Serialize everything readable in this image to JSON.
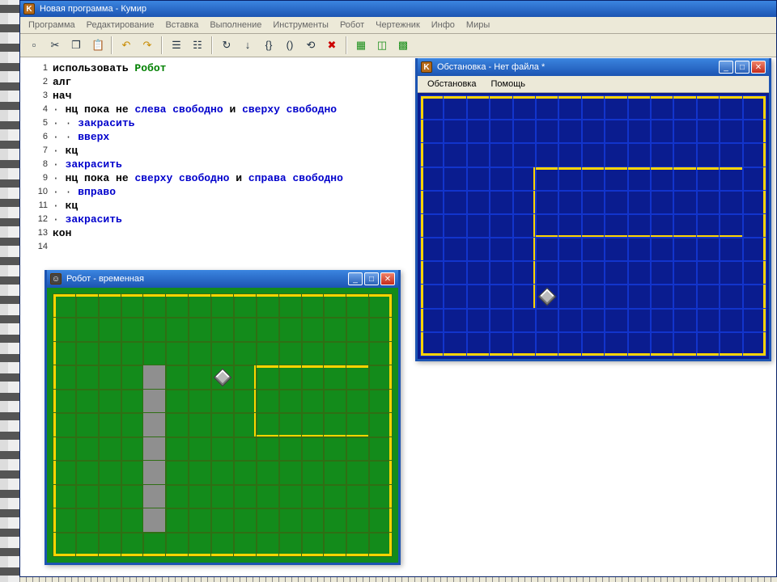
{
  "main_title": "Новая программа - Кумир",
  "menubar": [
    "Программа",
    "Редактирование",
    "Вставка",
    "Выполнение",
    "Инструменты",
    "Робот",
    "Чертежник",
    "Инфо",
    "Миры"
  ],
  "toolbar_icons": [
    {
      "name": "new-icon",
      "glyph": "▫"
    },
    {
      "name": "cut-icon",
      "glyph": "✂"
    },
    {
      "name": "copy-icon",
      "glyph": "❐"
    },
    {
      "name": "paste-icon",
      "glyph": "📋"
    },
    {
      "name": "sep"
    },
    {
      "name": "undo-icon",
      "glyph": "↶"
    },
    {
      "name": "redo-icon",
      "glyph": "↷"
    },
    {
      "name": "sep"
    },
    {
      "name": "list1-icon",
      "glyph": "☰"
    },
    {
      "name": "list2-icon",
      "glyph": "☷"
    },
    {
      "name": "sep"
    },
    {
      "name": "run-icon",
      "glyph": "↻"
    },
    {
      "name": "step-icon",
      "glyph": "↓"
    },
    {
      "name": "brace1-icon",
      "glyph": "{}"
    },
    {
      "name": "brace2-icon",
      "glyph": "()"
    },
    {
      "name": "trace-icon",
      "glyph": "⟲"
    },
    {
      "name": "stop-icon",
      "glyph": "✖"
    },
    {
      "name": "sep"
    },
    {
      "name": "tile1-icon",
      "glyph": "▦"
    },
    {
      "name": "tile2-icon",
      "glyph": "◫"
    },
    {
      "name": "tile3-icon",
      "glyph": "▩"
    }
  ],
  "code": [
    {
      "n": 1,
      "tokens": [
        [
          "kw",
          "использовать "
        ],
        [
          "ident",
          "Робот"
        ]
      ]
    },
    {
      "n": 2,
      "tokens": [
        [
          "kw",
          "алг"
        ]
      ]
    },
    {
      "n": 3,
      "tokens": [
        [
          "kw",
          "нач"
        ]
      ]
    },
    {
      "n": 4,
      "tokens": [
        [
          "dot",
          "· "
        ],
        [
          "kw",
          "нц пока не "
        ],
        [
          "kw2",
          "слева свободно"
        ],
        [
          "kw",
          " и "
        ],
        [
          "kw2",
          "сверху свободно"
        ]
      ]
    },
    {
      "n": 5,
      "tokens": [
        [
          "dot",
          "· · "
        ],
        [
          "kw2",
          "закрасить"
        ]
      ]
    },
    {
      "n": 6,
      "tokens": [
        [
          "dot",
          "· · "
        ],
        [
          "kw2",
          "вверх"
        ]
      ]
    },
    {
      "n": 7,
      "tokens": [
        [
          "dot",
          "· "
        ],
        [
          "kw",
          "кц"
        ]
      ]
    },
    {
      "n": 8,
      "tokens": [
        [
          "dot",
          "· "
        ],
        [
          "kw2",
          "закрасить"
        ]
      ]
    },
    {
      "n": 9,
      "tokens": [
        [
          "dot",
          "· "
        ],
        [
          "kw",
          "нц пока не "
        ],
        [
          "kw2",
          "сверху свободно"
        ],
        [
          "kw",
          " и "
        ],
        [
          "kw2",
          "справа свободно"
        ]
      ]
    },
    {
      "n": 10,
      "tokens": [
        [
          "dot",
          "· · "
        ],
        [
          "kw2",
          "вправо"
        ]
      ]
    },
    {
      "n": 11,
      "tokens": [
        [
          "dot",
          "· "
        ],
        [
          "kw",
          "кц"
        ]
      ]
    },
    {
      "n": 12,
      "tokens": [
        [
          "dot",
          "· "
        ],
        [
          "kw2",
          "закрасить"
        ]
      ]
    },
    {
      "n": 13,
      "tokens": [
        [
          "kw",
          "кон"
        ]
      ]
    },
    {
      "n": 14,
      "tokens": []
    }
  ],
  "robot_window": {
    "title": "Робот - временная",
    "cols": 15,
    "rows": 11,
    "outer_border": true,
    "robot": {
      "col": 7,
      "row": 3
    },
    "painted": [
      [
        4,
        3
      ],
      [
        4,
        4
      ],
      [
        4,
        5
      ],
      [
        4,
        6
      ],
      [
        4,
        7
      ],
      [
        4,
        8
      ],
      [
        4,
        9
      ]
    ],
    "walls": [
      {
        "col": 9,
        "row": 3,
        "side": "top"
      },
      {
        "col": 10,
        "row": 3,
        "side": "top"
      },
      {
        "col": 11,
        "row": 3,
        "side": "top"
      },
      {
        "col": 12,
        "row": 3,
        "side": "top"
      },
      {
        "col": 13,
        "row": 3,
        "side": "top"
      },
      {
        "col": 8,
        "row": 3,
        "side": "right"
      },
      {
        "col": 8,
        "row": 4,
        "side": "right"
      },
      {
        "col": 8,
        "row": 5,
        "side": "right"
      },
      {
        "col": 9,
        "row": 5,
        "side": "bottom"
      },
      {
        "col": 10,
        "row": 5,
        "side": "bottom"
      },
      {
        "col": 11,
        "row": 5,
        "side": "bottom"
      },
      {
        "col": 12,
        "row": 5,
        "side": "bottom"
      },
      {
        "col": 13,
        "row": 5,
        "side": "bottom"
      }
    ]
  },
  "blue_window": {
    "title": "Обстановка - Нет файла *",
    "menu": [
      "Обстановка",
      "Помощь"
    ],
    "cols": 15,
    "rows": 11,
    "outer_border": true,
    "robot": {
      "col": 5,
      "row": 8
    },
    "walls": [
      {
        "col": 5,
        "row": 3,
        "side": "top"
      },
      {
        "col": 6,
        "row": 3,
        "side": "top"
      },
      {
        "col": 7,
        "row": 3,
        "side": "top"
      },
      {
        "col": 8,
        "row": 3,
        "side": "top"
      },
      {
        "col": 9,
        "row": 3,
        "side": "top"
      },
      {
        "col": 10,
        "row": 3,
        "side": "top"
      },
      {
        "col": 11,
        "row": 3,
        "side": "top"
      },
      {
        "col": 12,
        "row": 3,
        "side": "top"
      },
      {
        "col": 13,
        "row": 3,
        "side": "top"
      },
      {
        "col": 4,
        "row": 3,
        "side": "right"
      },
      {
        "col": 4,
        "row": 4,
        "side": "right"
      },
      {
        "col": 4,
        "row": 5,
        "side": "right"
      },
      {
        "col": 4,
        "row": 6,
        "side": "right"
      },
      {
        "col": 4,
        "row": 7,
        "side": "right"
      },
      {
        "col": 4,
        "row": 8,
        "side": "right"
      },
      {
        "col": 5,
        "row": 5,
        "side": "bottom"
      },
      {
        "col": 6,
        "row": 5,
        "side": "bottom"
      },
      {
        "col": 7,
        "row": 5,
        "side": "bottom"
      },
      {
        "col": 8,
        "row": 5,
        "side": "bottom"
      },
      {
        "col": 9,
        "row": 5,
        "side": "bottom"
      },
      {
        "col": 10,
        "row": 5,
        "side": "bottom"
      },
      {
        "col": 11,
        "row": 5,
        "side": "bottom"
      },
      {
        "col": 12,
        "row": 5,
        "side": "bottom"
      },
      {
        "col": 13,
        "row": 5,
        "side": "bottom"
      }
    ]
  },
  "win_controls": {
    "min": "_",
    "max": "□",
    "close": "✕"
  }
}
